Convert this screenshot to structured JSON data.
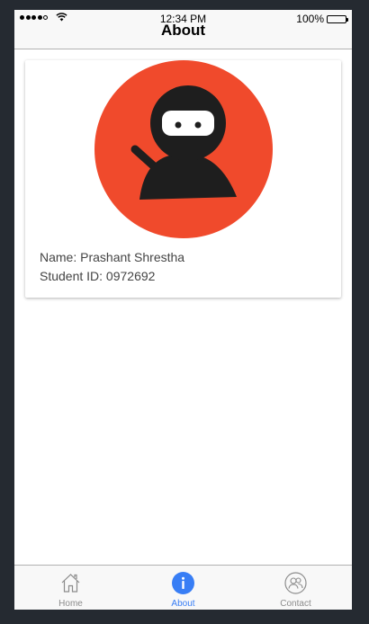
{
  "status_bar": {
    "time": "12:34 PM",
    "battery": "100%",
    "signal_bars": 5,
    "signal_filled": 4
  },
  "header": {
    "title": "About"
  },
  "profile": {
    "avatar": "ninja-avatar",
    "name_line": "Name: Prashant Shrestha",
    "student_id_line": "Student ID: 0972692"
  },
  "tabs": [
    {
      "label": "Home",
      "icon": "home-icon",
      "active": false
    },
    {
      "label": "About",
      "icon": "info-icon",
      "active": true
    },
    {
      "label": "Contact",
      "icon": "contact-icon",
      "active": false
    }
  ],
  "colors": {
    "accent": "#387ef5",
    "avatar_bg": "#f04a2c",
    "tab_inactive": "#8c8c8c",
    "app_background": "#252a31"
  }
}
